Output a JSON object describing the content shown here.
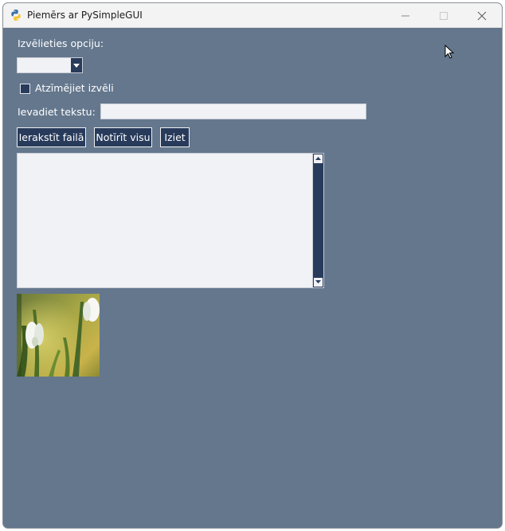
{
  "window": {
    "title": "Piemērs ar PySimpleGUI",
    "app_icon": "python-logo-icon",
    "controls": [
      "minimize-icon",
      "maximize-icon",
      "close-icon"
    ]
  },
  "form": {
    "combo_label": "Izvēlieties opciju:",
    "combo_value": "",
    "checkbox_label": "Atzīmējiet izvēli",
    "checkbox_checked": false,
    "text_label": "Ievadiet tekstu:",
    "text_value": "",
    "buttons": {
      "save": "Ierakstīt failā",
      "clear": "Notīrīt visu",
      "exit": "Iziet"
    },
    "multiline_value": ""
  },
  "image": {
    "subject": "snowdrop-flowers-photo"
  },
  "colors": {
    "background": "#64778d",
    "button_bg": "#283b5b",
    "button_text": "#ffffff",
    "input_bg": "#f1f2f6",
    "label_text": "#ffffff",
    "titlebar": "#f3f3f3"
  }
}
